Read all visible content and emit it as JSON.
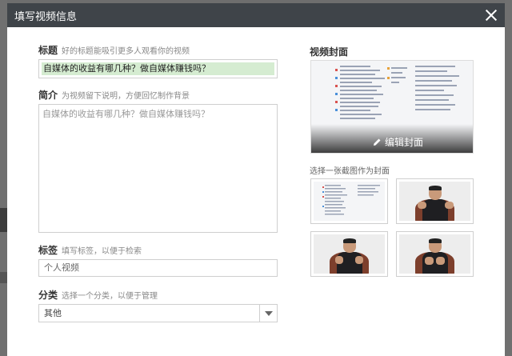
{
  "dialog": {
    "title": "填写视频信息"
  },
  "title_field": {
    "label": "标题",
    "hint": "好的标题能吸引更多人观看你的视频",
    "value": "自媒体的收益有哪几种？做自媒体赚钱吗？"
  },
  "description": {
    "label": "简介",
    "hint": "为视频留下说明，方便回忆制作背景",
    "value": "自媒体的收益有哪几种？做自媒体赚钱吗？"
  },
  "tags": {
    "label": "标签",
    "hint": "填写标签，以便于检索",
    "value": "个人视频"
  },
  "category": {
    "label": "分类",
    "hint": "选择一个分类，以便于管理",
    "selected": "其他"
  },
  "cover": {
    "label": "视频封面",
    "edit_label": "编辑封面",
    "pick_label": "选择一张截图作为封面"
  },
  "icons": [
    "close-icon",
    "pencil-icon",
    "chevron-down-icon"
  ]
}
